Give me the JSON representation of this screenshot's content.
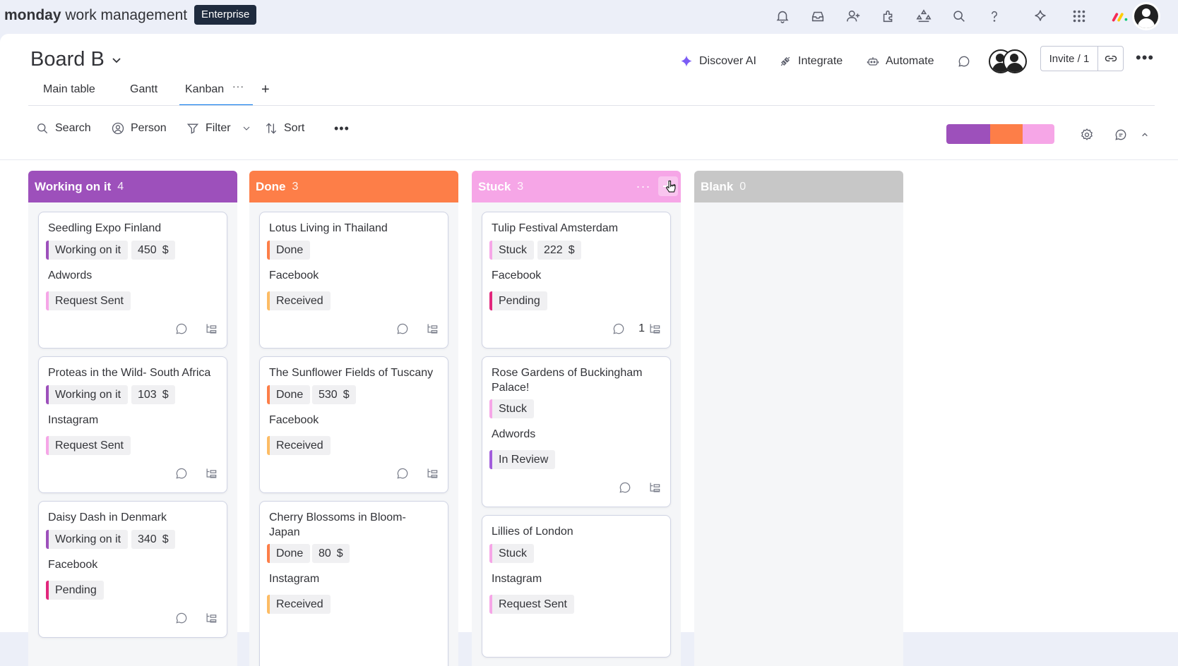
{
  "app": {
    "brand_bold": "monday",
    "brand_rest": " work management",
    "plan": "Enterprise"
  },
  "topbar_icons": [
    "bell-icon",
    "inbox-icon",
    "invite-members-icon",
    "apps-icon",
    "integrations-icon",
    "search-icon",
    "help-icon",
    "ai-sparkle-icon",
    "grid-menu-icon"
  ],
  "board": {
    "title": "Board B"
  },
  "header": {
    "discover_ai": "Discover AI",
    "integrate": "Integrate",
    "automate": "Automate",
    "invite": "Invite / 1"
  },
  "tabs": [
    {
      "label": "Main table"
    },
    {
      "label": "Gantt"
    },
    {
      "label": "Kanban",
      "active": true
    }
  ],
  "toolbar": {
    "search": "Search",
    "person": "Person",
    "filter": "Filter",
    "sort": "Sort"
  },
  "colors": {
    "working": "#9d50bb",
    "done": "#fd7e48",
    "stuck": "#f6a6e7",
    "blank": "#c7c7c7",
    "tag_pink": "#f6a6e7",
    "tag_yellow": "#fdbc64",
    "tag_hotpink": "#e2267c",
    "tag_purple": "#a25ddc"
  },
  "columns": [
    {
      "name": "Working on it",
      "count": "4",
      "cards": [
        {
          "title": "Seedling Expo Finland",
          "status": "Working on it",
          "amount": "450",
          "currency": "$",
          "channel": "Adwords",
          "stage": "Request Sent"
        },
        {
          "title": "Proteas in the Wild- South Africa",
          "status": "Working on it",
          "amount": "103",
          "currency": "$",
          "channel": "Instagram",
          "stage": "Request Sent"
        },
        {
          "title": "Daisy Dash in Denmark",
          "status": "Working on it",
          "amount": "340",
          "currency": "$",
          "channel": "Facebook",
          "stage": "Pending"
        }
      ]
    },
    {
      "name": "Done",
      "count": "3",
      "cards": [
        {
          "title": "Lotus Living in Thailand",
          "status": "Done",
          "channel": "Facebook",
          "stage": "Received"
        },
        {
          "title": "The Sunflower Fields of Tuscany",
          "status": "Done",
          "amount": "530",
          "currency": "$",
          "channel": "Facebook",
          "stage": "Received"
        },
        {
          "title": "Cherry Blossoms in Bloom- Japan",
          "status": "Done",
          "amount": "80",
          "currency": "$",
          "channel": "Instagram",
          "stage": "Received"
        }
      ]
    },
    {
      "name": "Stuck",
      "count": "3",
      "cards": [
        {
          "title": "Tulip Festival Amsterdam",
          "status": "Stuck",
          "amount": "222",
          "currency": "$",
          "channel": "Facebook",
          "stage": "Pending",
          "subitems": "1"
        },
        {
          "title": "Rose Gardens of Buckingham Palace!",
          "status": "Stuck",
          "channel": "Adwords",
          "stage": "In Review"
        },
        {
          "title": "Lillies of London",
          "status": "Stuck",
          "channel": "Instagram",
          "stage": "Request Sent"
        }
      ]
    },
    {
      "name": "Blank",
      "count": "0",
      "cards": []
    }
  ]
}
